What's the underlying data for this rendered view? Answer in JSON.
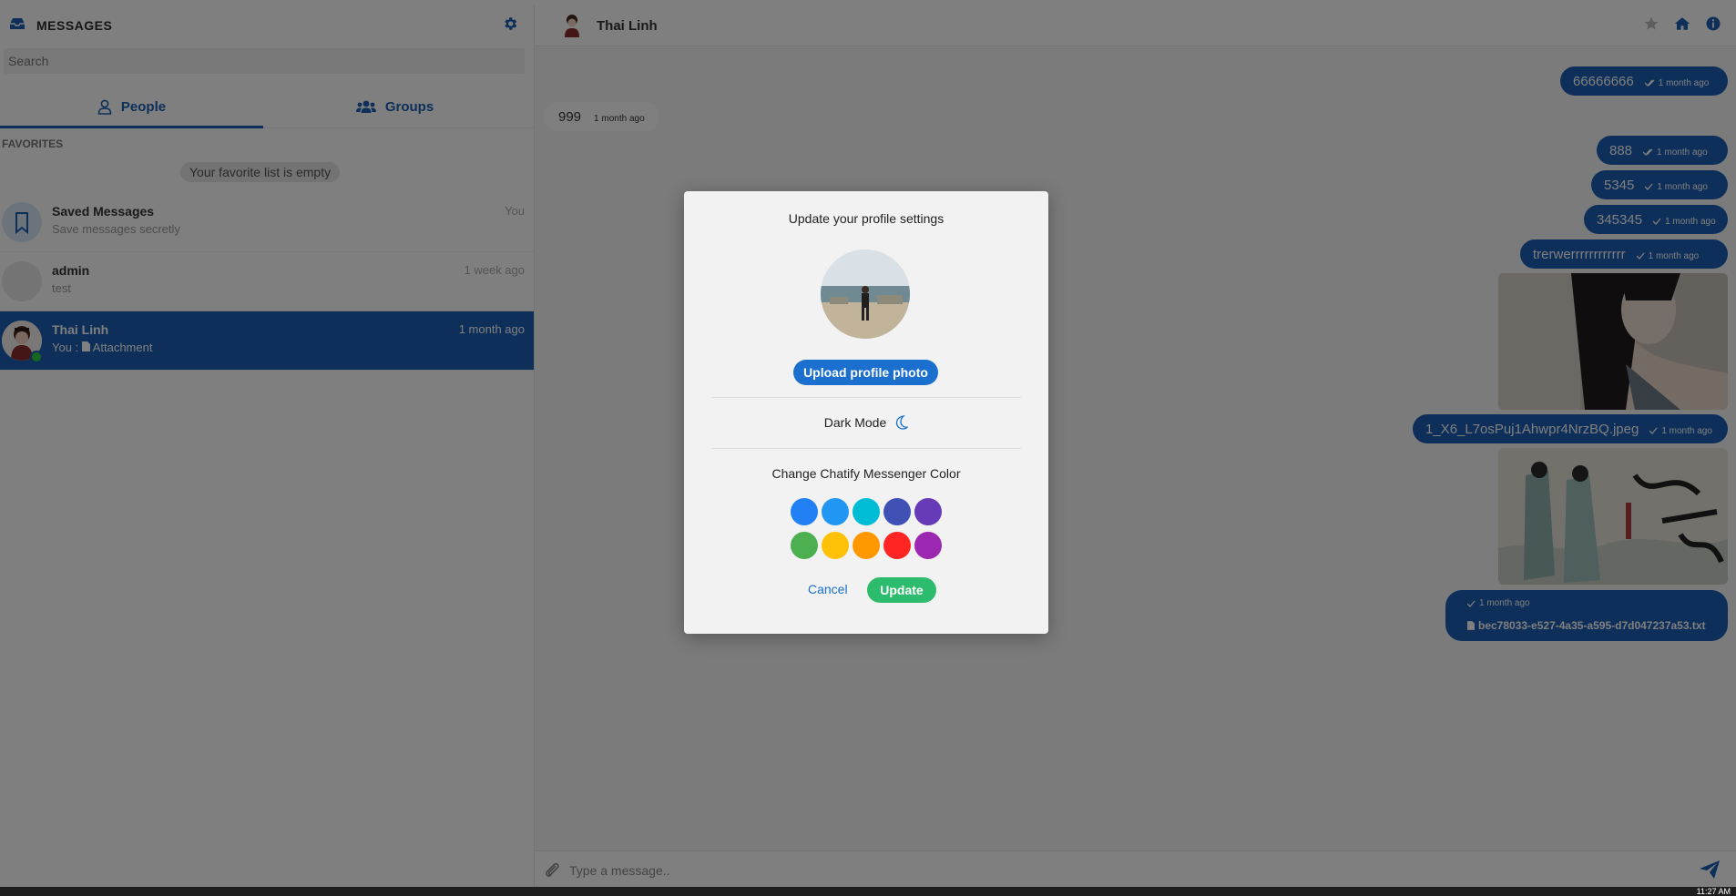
{
  "sidebar": {
    "title": "MESSAGES",
    "icon": "inbox-icon",
    "settings_icon": "gear-icon",
    "search_placeholder": "Search",
    "tabs": [
      {
        "label": "People",
        "icon": "user-icon"
      },
      {
        "label": "Groups",
        "icon": "users-icon"
      }
    ],
    "favorites_label": "FAVORITES",
    "favorites_empty": "Your favorite list is empty",
    "contacts": [
      {
        "name": "Saved Messages",
        "preview": "Save messages secretly",
        "time": "You"
      },
      {
        "name": "admin",
        "preview": "test",
        "time": "1 week ago"
      },
      {
        "name": "Thai Linh",
        "preview_prefix": "You :",
        "preview": "Attachment",
        "time": "1 month ago"
      }
    ]
  },
  "chat": {
    "contact_name": "Thai Linh",
    "header_icons": [
      "star-icon",
      "home-icon",
      "info-icon"
    ],
    "messages": [
      {
        "text": "66666666",
        "time": "1 month ago"
      },
      {
        "text": "999",
        "time": "1 month ago"
      },
      {
        "text": "888",
        "time": "1 month ago"
      },
      {
        "text": "5345",
        "time": "1 month ago"
      },
      {
        "text": "345345",
        "time": "1 month ago"
      },
      {
        "text": "trerwerrrrrrrrrrrr",
        "time": "1 month ago"
      },
      {
        "text": "1_X6_L7osPuj1Ahwpr4NrzBQ.jpeg",
        "time": "1 month ago"
      },
      {
        "text": "bec78033-e527-4a35-a595-d7d047237a53.txt",
        "time": "1 month ago"
      }
    ],
    "input_placeholder": "Type a message.."
  },
  "modal": {
    "title": "Update your profile settings",
    "upload_label": "Upload profile photo",
    "dark_mode_label": "Dark Mode",
    "color_title": "Change Chatify Messenger Color",
    "colors": [
      "#2180f3",
      "#2196f3",
      "#00bcd4",
      "#3f51b5",
      "#673ab7",
      "#4caf50",
      "#ffc107",
      "#ff9800",
      "#ff2522",
      "#9c27b0"
    ],
    "cancel_label": "Cancel",
    "update_label": "Update"
  },
  "taskbar": {
    "clock": "11:27 AM"
  }
}
